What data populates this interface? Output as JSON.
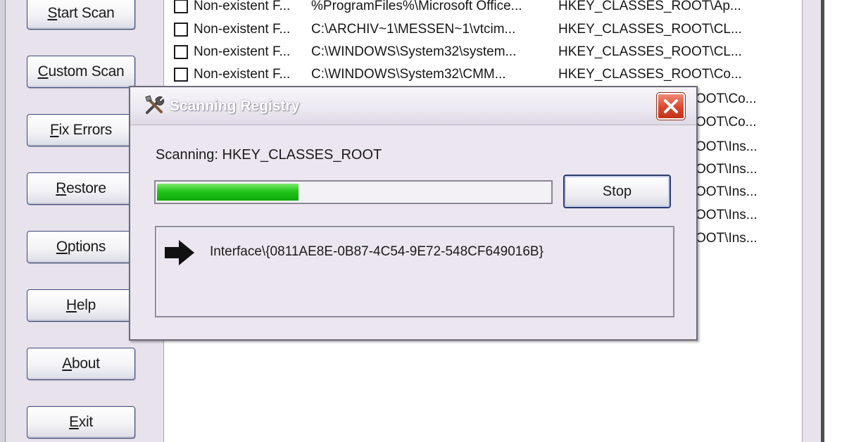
{
  "sidebar": {
    "buttons": [
      {
        "accel": "S",
        "rest": "tart Scan"
      },
      {
        "accel": "C",
        "rest": "ustom Scan"
      },
      {
        "accel": "F",
        "rest": "ix Errors"
      },
      {
        "accel": "R",
        "rest": "estore"
      },
      {
        "accel": "O",
        "rest": "ptions"
      },
      {
        "accel": "H",
        "rest": "elp"
      },
      {
        "accel": "A",
        "rest": "bout"
      },
      {
        "accel": "E",
        "rest": "xit"
      }
    ]
  },
  "results": {
    "rows": [
      {
        "problem": "Non-existent F...",
        "data": "%ProgramFiles%\\Microsoft Office...",
        "location": "HKEY_CLASSES_ROOT\\Ap..."
      },
      {
        "problem": "Non-existent F...",
        "data": "C:\\ARCHIV~1\\MESSEN~1\\vtcim...",
        "location": "HKEY_CLASSES_ROOT\\CL..."
      },
      {
        "problem": "Non-existent F...",
        "data": "C:\\WINDOWS\\System32\\system...",
        "location": "HKEY_CLASSES_ROOT\\CL..."
      },
      {
        "problem": "Non-existent F...",
        "data": "C:\\WINDOWS\\System32\\CMM...",
        "location": "HKEY_CLASSES_ROOT\\Co..."
      }
    ],
    "partial_locations": [
      "OOT\\Co...",
      "OOT\\Co...",
      "OOT\\Ins...",
      "OOT\\Ins...",
      "OOT\\Ins...",
      "OOT\\Ins...",
      "OOT\\Ins..."
    ]
  },
  "dialog": {
    "title": "Scanning Registry",
    "status": "Scanning: HKEY_CLASSES_ROOT",
    "progress": 0.36,
    "stop_label": "Stop",
    "current_key": "Interface\\{0811AE8E-0B87-4C54-9E72-548CF649016B}",
    "icon": "tools-icon",
    "arrow_icon": "right-arrow-icon",
    "close_icon": "close-icon"
  }
}
